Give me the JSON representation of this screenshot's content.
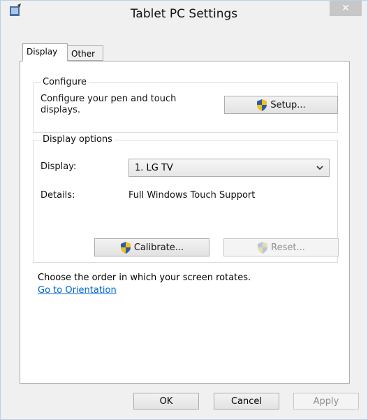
{
  "window": {
    "title": "Tablet PC Settings",
    "close_symbol": "✕"
  },
  "tabs": [
    {
      "label": "Display",
      "active": true
    },
    {
      "label": "Other",
      "active": false
    }
  ],
  "configure": {
    "legend": "Configure",
    "description": "Configure your pen and touch displays.",
    "setup_label": "Setup..."
  },
  "display_options": {
    "legend": "Display options",
    "display_label": "Display:",
    "display_value": "1. LG TV",
    "details_label": "Details:",
    "details_value": "Full Windows Touch Support",
    "calibrate_label": "Calibrate...",
    "reset_label": "Reset..."
  },
  "orientation": {
    "text": "Choose the order in which your screen rotates.",
    "link": "Go to Orientation"
  },
  "footer": {
    "ok": "OK",
    "cancel": "Cancel",
    "apply": "Apply"
  },
  "icons": {
    "shield": "shield-icon",
    "app": "tablet-settings-icon",
    "dropdown": "chevron-down-icon"
  }
}
